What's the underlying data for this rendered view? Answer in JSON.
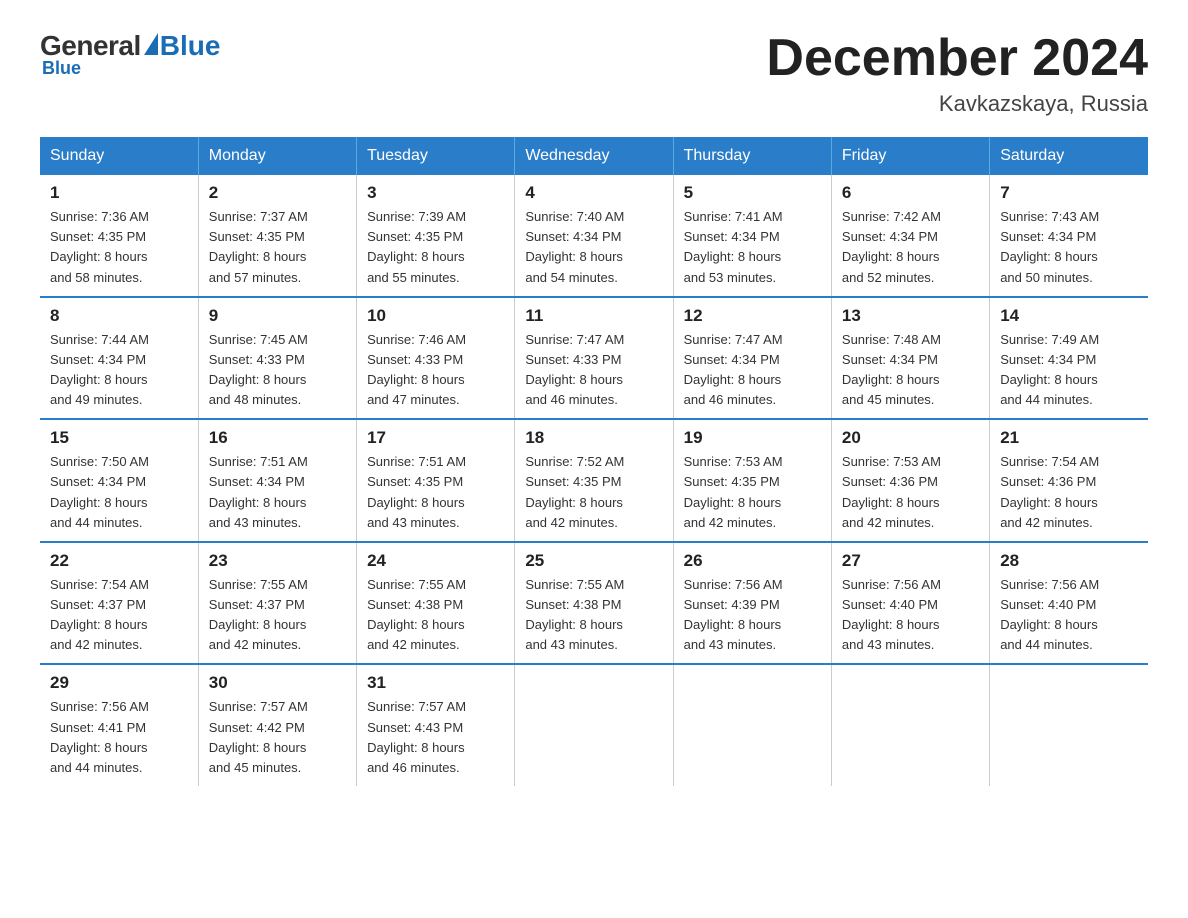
{
  "logo": {
    "general": "General",
    "blue": "Blue",
    "triangle_color": "#1a6db5"
  },
  "title": "December 2024",
  "location": "Kavkazskaya, Russia",
  "days_of_week": [
    "Sunday",
    "Monday",
    "Tuesday",
    "Wednesday",
    "Thursday",
    "Friday",
    "Saturday"
  ],
  "weeks": [
    [
      {
        "day": "1",
        "sunrise": "7:36 AM",
        "sunset": "4:35 PM",
        "daylight": "8 hours and 58 minutes."
      },
      {
        "day": "2",
        "sunrise": "7:37 AM",
        "sunset": "4:35 PM",
        "daylight": "8 hours and 57 minutes."
      },
      {
        "day": "3",
        "sunrise": "7:39 AM",
        "sunset": "4:35 PM",
        "daylight": "8 hours and 55 minutes."
      },
      {
        "day": "4",
        "sunrise": "7:40 AM",
        "sunset": "4:34 PM",
        "daylight": "8 hours and 54 minutes."
      },
      {
        "day": "5",
        "sunrise": "7:41 AM",
        "sunset": "4:34 PM",
        "daylight": "8 hours and 53 minutes."
      },
      {
        "day": "6",
        "sunrise": "7:42 AM",
        "sunset": "4:34 PM",
        "daylight": "8 hours and 52 minutes."
      },
      {
        "day": "7",
        "sunrise": "7:43 AM",
        "sunset": "4:34 PM",
        "daylight": "8 hours and 50 minutes."
      }
    ],
    [
      {
        "day": "8",
        "sunrise": "7:44 AM",
        "sunset": "4:34 PM",
        "daylight": "8 hours and 49 minutes."
      },
      {
        "day": "9",
        "sunrise": "7:45 AM",
        "sunset": "4:33 PM",
        "daylight": "8 hours and 48 minutes."
      },
      {
        "day": "10",
        "sunrise": "7:46 AM",
        "sunset": "4:33 PM",
        "daylight": "8 hours and 47 minutes."
      },
      {
        "day": "11",
        "sunrise": "7:47 AM",
        "sunset": "4:33 PM",
        "daylight": "8 hours and 46 minutes."
      },
      {
        "day": "12",
        "sunrise": "7:47 AM",
        "sunset": "4:34 PM",
        "daylight": "8 hours and 46 minutes."
      },
      {
        "day": "13",
        "sunrise": "7:48 AM",
        "sunset": "4:34 PM",
        "daylight": "8 hours and 45 minutes."
      },
      {
        "day": "14",
        "sunrise": "7:49 AM",
        "sunset": "4:34 PM",
        "daylight": "8 hours and 44 minutes."
      }
    ],
    [
      {
        "day": "15",
        "sunrise": "7:50 AM",
        "sunset": "4:34 PM",
        "daylight": "8 hours and 44 minutes."
      },
      {
        "day": "16",
        "sunrise": "7:51 AM",
        "sunset": "4:34 PM",
        "daylight": "8 hours and 43 minutes."
      },
      {
        "day": "17",
        "sunrise": "7:51 AM",
        "sunset": "4:35 PM",
        "daylight": "8 hours and 43 minutes."
      },
      {
        "day": "18",
        "sunrise": "7:52 AM",
        "sunset": "4:35 PM",
        "daylight": "8 hours and 42 minutes."
      },
      {
        "day": "19",
        "sunrise": "7:53 AM",
        "sunset": "4:35 PM",
        "daylight": "8 hours and 42 minutes."
      },
      {
        "day": "20",
        "sunrise": "7:53 AM",
        "sunset": "4:36 PM",
        "daylight": "8 hours and 42 minutes."
      },
      {
        "day": "21",
        "sunrise": "7:54 AM",
        "sunset": "4:36 PM",
        "daylight": "8 hours and 42 minutes."
      }
    ],
    [
      {
        "day": "22",
        "sunrise": "7:54 AM",
        "sunset": "4:37 PM",
        "daylight": "8 hours and 42 minutes."
      },
      {
        "day": "23",
        "sunrise": "7:55 AM",
        "sunset": "4:37 PM",
        "daylight": "8 hours and 42 minutes."
      },
      {
        "day": "24",
        "sunrise": "7:55 AM",
        "sunset": "4:38 PM",
        "daylight": "8 hours and 42 minutes."
      },
      {
        "day": "25",
        "sunrise": "7:55 AM",
        "sunset": "4:38 PM",
        "daylight": "8 hours and 43 minutes."
      },
      {
        "day": "26",
        "sunrise": "7:56 AM",
        "sunset": "4:39 PM",
        "daylight": "8 hours and 43 minutes."
      },
      {
        "day": "27",
        "sunrise": "7:56 AM",
        "sunset": "4:40 PM",
        "daylight": "8 hours and 43 minutes."
      },
      {
        "day": "28",
        "sunrise": "7:56 AM",
        "sunset": "4:40 PM",
        "daylight": "8 hours and 44 minutes."
      }
    ],
    [
      {
        "day": "29",
        "sunrise": "7:56 AM",
        "sunset": "4:41 PM",
        "daylight": "8 hours and 44 minutes."
      },
      {
        "day": "30",
        "sunrise": "7:57 AM",
        "sunset": "4:42 PM",
        "daylight": "8 hours and 45 minutes."
      },
      {
        "day": "31",
        "sunrise": "7:57 AM",
        "sunset": "4:43 PM",
        "daylight": "8 hours and 46 minutes."
      },
      null,
      null,
      null,
      null
    ]
  ],
  "labels": {
    "sunrise": "Sunrise:",
    "sunset": "Sunset:",
    "daylight": "Daylight:"
  }
}
